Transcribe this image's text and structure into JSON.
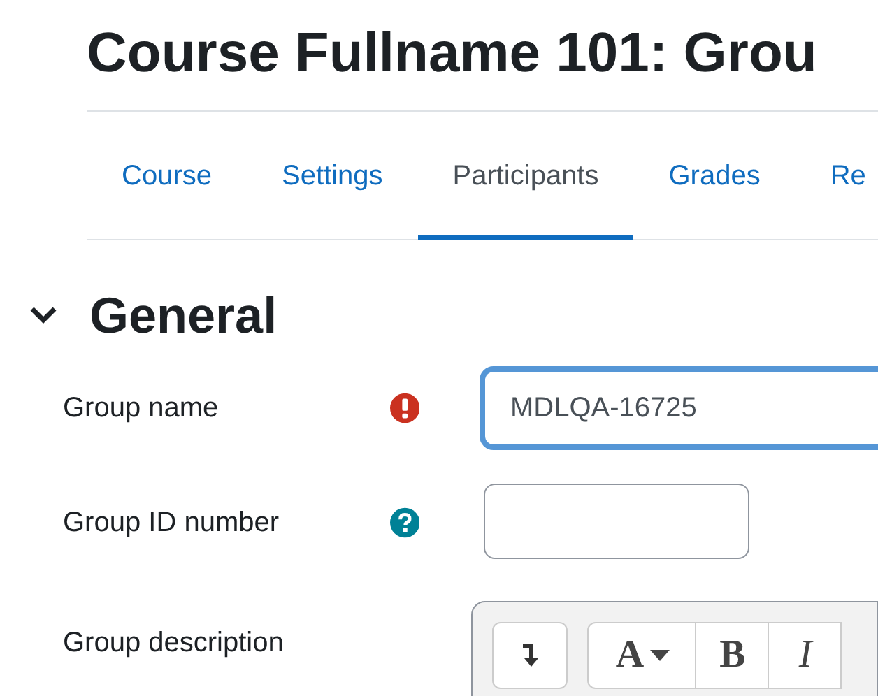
{
  "page_title": "Course Fullname 101: Grou",
  "tabs": [
    {
      "label": "Course",
      "selected": false
    },
    {
      "label": "Settings",
      "selected": false
    },
    {
      "label": "Participants",
      "selected": true
    },
    {
      "label": "Grades",
      "selected": false
    },
    {
      "label": "Re",
      "selected": false
    }
  ],
  "section": {
    "title": "General",
    "expanded": true
  },
  "fields": [
    {
      "label": "Group name",
      "kind": "text",
      "required": true,
      "help": false,
      "value": "MDLQA-16725",
      "focused": true
    },
    {
      "label": "Group ID number",
      "kind": "text",
      "required": false,
      "help": true,
      "focused": false
    },
    {
      "label": "Group description",
      "kind": "editor",
      "required": false,
      "help": false,
      "toolbar": [
        {
          "kind": "collapse"
        },
        {
          "kind": "font",
          "label": "A"
        },
        {
          "kind": "bold",
          "label": "B"
        },
        {
          "kind": "italic",
          "label": "I"
        }
      ]
    }
  ]
}
